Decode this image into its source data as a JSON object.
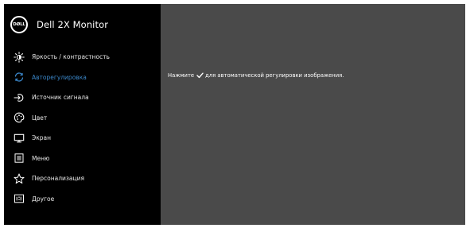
{
  "brand": {
    "logo_text": "DØLL",
    "title": "Dell 2X Monitor"
  },
  "colors": {
    "active": "#3a86c8",
    "panel": "#4a4a4a",
    "sidebar": "#000000"
  },
  "menu": {
    "items": [
      {
        "label": "Яркость / контрастность",
        "icon": "brightness-icon",
        "active": false
      },
      {
        "label": "Авторегулировка",
        "icon": "auto-adjust-icon",
        "active": true
      },
      {
        "label": "Источник сигнала",
        "icon": "input-source-icon",
        "active": false
      },
      {
        "label": "Цвет",
        "icon": "color-icon",
        "active": false
      },
      {
        "label": "Экран",
        "icon": "display-icon",
        "active": false
      },
      {
        "label": "Меню",
        "icon": "menu-icon",
        "active": false
      },
      {
        "label": "Персонализация",
        "icon": "star-icon",
        "active": false
      },
      {
        "label": "Другое",
        "icon": "other-icon",
        "active": false
      }
    ]
  },
  "content": {
    "instruction_prefix": "Нажмите",
    "instruction_icon": "checkmark-icon",
    "instruction_suffix": "для автоматической регулировки изображения."
  }
}
